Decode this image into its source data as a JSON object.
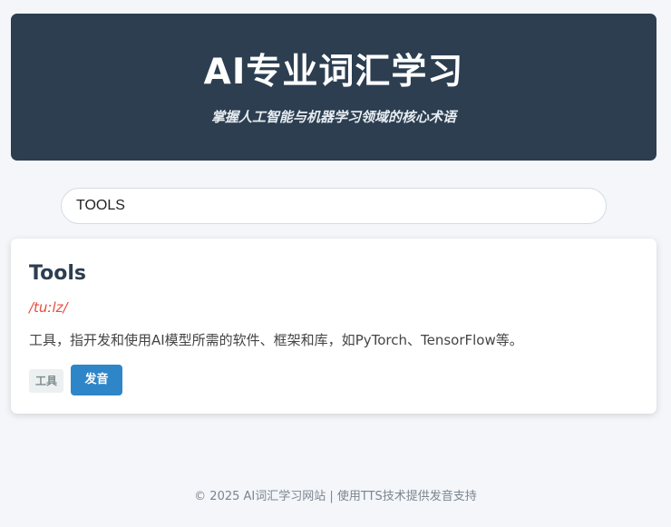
{
  "header": {
    "title": "AI专业词汇学习",
    "subtitle": "掌握人工智能与机器学习领域的核心术语"
  },
  "search": {
    "value": "TOOLS"
  },
  "card": {
    "word": "Tools",
    "phonetic": "/tuːlz/",
    "definition": "工具，指开发和使用AI模型所需的软件、框架和库，如PyTorch、TensorFlow等。",
    "tag": "工具",
    "speak_label": "发音"
  },
  "footer": {
    "text": "© 2025 AI词汇学习网站 | 使用TTS技术提供发音支持"
  },
  "colors": {
    "header_bg": "#2c3e50",
    "phonetic": "#e74c3c",
    "button": "#2e86c8",
    "page_bg": "#f4f6fa"
  }
}
